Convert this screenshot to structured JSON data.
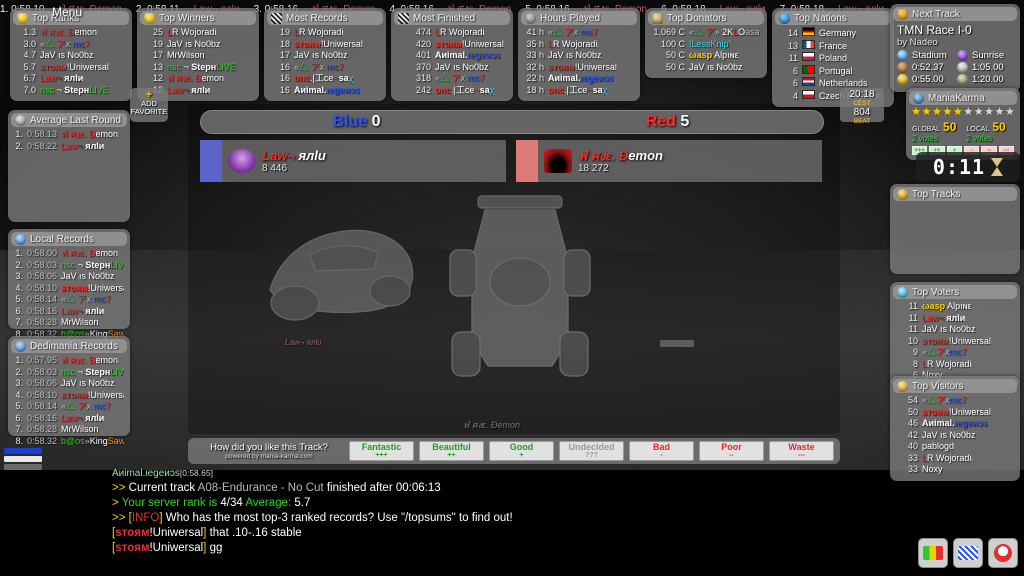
{
  "ticker": [
    "1. 0:58.10",
    "ฟ่ ศงε. Ðemon",
    "2. 0:58.11",
    "Law¬ ялlи",
    "3. 0:58.16",
    "ฟ่ ศงε. Ðemon",
    "4. 0:58.16",
    "ฟ่ ศงε. Ðemon",
    "5. 0:58.16",
    "ฟ่ ศงε. Ðemon",
    "6. 0:58.18",
    "Law¬ ялlи",
    "7. 0:58.18",
    "Law¬ ялlи"
  ],
  "menu_overlay": "Menu",
  "top_panels": [
    {
      "title": "Top Ranks",
      "icon": "cup-icon",
      "rows": [
        {
          "rank": "1.3",
          "name": "ฟ่ ศงε. Ðemon"
        },
        {
          "rank": "3.0",
          "name": "«△ アх mc7"
        },
        {
          "rank": "4.7",
          "name": "JaV ıs No0bz"
        },
        {
          "rank": "5.7",
          "name": "sтoям!Uniwersal"
        },
        {
          "rank": "6.7",
          "name": "Law¬ ялlи"
        },
        {
          "rank": "7.0",
          "name": "nsc ¬ StepнLIVE"
        }
      ]
    },
    {
      "title": "Top Winners",
      "icon": "cup-icon",
      "rows": [
        {
          "rank": "25",
          "name": "LR  Wojoradi"
        },
        {
          "rank": "19",
          "name": "JaV ıs No0bz"
        },
        {
          "rank": "17",
          "name": "MrWilson"
        },
        {
          "rank": "13",
          "name": "nsc ¬ StepнLIVE"
        },
        {
          "rank": "12",
          "name": "ฟ่ ศงε. Ðemon"
        },
        {
          "rank": "12",
          "name": "Law¬ ялlи"
        }
      ]
    },
    {
      "title": "Most Records",
      "icon": "checkered-flag-icon",
      "rows": [
        {
          "rank": "19",
          "name": "LR  Wojoradi"
        },
        {
          "rank": "18",
          "name": "sтoям!Uniwersal"
        },
        {
          "rank": "17",
          "name": "JaV ıs No0bz"
        },
        {
          "rank": "16",
          "name": "«△ アх mc7"
        },
        {
          "rank": "16",
          "name": "onc.|工ce¬saχ"
        },
        {
          "rank": "16",
          "name": "Aиimal.ιegeиɔs"
        }
      ]
    },
    {
      "title": "Most Finished",
      "icon": "checkered-flag-icon",
      "rows": [
        {
          "rank": "474",
          "name": "LR  Wojoradi"
        },
        {
          "rank": "420",
          "name": "sтoям!Uniwersal"
        },
        {
          "rank": "401",
          "name": "Aиimal.ιegeиɔs"
        },
        {
          "rank": "370",
          "name": "JaV ıs No0bz"
        },
        {
          "rank": "318",
          "name": "«△ アх mc7"
        },
        {
          "rank": "242",
          "name": "onc.|工ce¬saχ"
        }
      ]
    },
    {
      "title": "Hours Played",
      "icon": "clock-icon",
      "rows": [
        {
          "rank": "41 h",
          "name": "«△ アх mc7"
        },
        {
          "rank": "35 h",
          "name": "LR  Wojoradi"
        },
        {
          "rank": "33 h",
          "name": "JaV ıs No0bz"
        },
        {
          "rank": "32 h",
          "name": "sтoям!Uniwersal"
        },
        {
          "rank": "22 h",
          "name": "Aиimal.ιegeиɔs"
        },
        {
          "rank": "18 h",
          "name": "onc.|工ce¬saχ"
        }
      ]
    },
    {
      "title": "Top Donators",
      "icon": "money-icon",
      "rows": [
        {
          "rank": "1,069 C",
          "name": "«△ ア» 2KLOasa"
        },
        {
          "rank": "100 C",
          "name": "!LessKnip'"
        },
        {
          "rank": "50 C",
          "name": "ωasp Alpıɴε"
        },
        {
          "rank": "50 C",
          "name": "JaV ıs No0bz"
        }
      ]
    },
    {
      "title": "Top Nations",
      "icon": "globe-icon",
      "rows": [
        {
          "rank": "14",
          "flag": "de",
          "name": "Germany"
        },
        {
          "rank": "13",
          "flag": "fr",
          "name": "France"
        },
        {
          "rank": "11",
          "flag": "pl",
          "name": "Poland"
        },
        {
          "rank": "6",
          "flag": "pt",
          "name": "Portugal"
        },
        {
          "rank": "6",
          "flag": "nl",
          "name": "Netherlands"
        },
        {
          "rank": "4",
          "flag": "cz",
          "name": "Czech Republic"
        }
      ]
    }
  ],
  "left_panels": [
    {
      "title": "Average Last Round",
      "icon": "average-icon",
      "rows": [
        {
          "rank": "1.",
          "time": "0:58.13",
          "name": "ฟ่ ศงε. Ðemon"
        },
        {
          "rank": "2.",
          "time": "0:58.22",
          "name": "Law¬ ялlи"
        }
      ]
    },
    {
      "title": "Local Records",
      "icon": "records-icon",
      "rows": [
        {
          "rank": "1.",
          "time": "0:58.00",
          "name": "ฟ่ ศงε. Ðemon"
        },
        {
          "rank": "2.",
          "time": "0:58.03",
          "name": "nsc ¬ StepнLIVE"
        },
        {
          "rank": "3.",
          "time": "0:58.06",
          "name": "JaV ıs No0bz"
        },
        {
          "rank": "4.",
          "time": "0:58.10",
          "name": "sтoям!Uniwersal"
        },
        {
          "rank": "5.",
          "time": "0:58.14",
          "name": "«△ アх mc7"
        },
        {
          "rank": "6.",
          "time": "0:58.16",
          "name": "Law¬ ялlи"
        },
        {
          "rank": "7.",
          "time": "0:58.28",
          "name": "MrWilson"
        },
        {
          "rank": "8.",
          "time": "0:58.32",
          "name": "b@os»KingSawyer!"
        }
      ]
    },
    {
      "title": "Dedimania Records",
      "icon": "records-icon",
      "rows": [
        {
          "rank": "1.",
          "time": "0:57.95",
          "name": "ฟ่ ศงε. Ðemon"
        },
        {
          "rank": "2.",
          "time": "0:58.03",
          "name": "nsc ¬ StepнLIVE"
        },
        {
          "rank": "3.",
          "time": "0:58.06",
          "name": "JaV ıs No0bz"
        },
        {
          "rank": "4.",
          "time": "0:58.10",
          "name": "sтoям!Uniwersal"
        },
        {
          "rank": "5.",
          "time": "0:58.14",
          "name": "«△ アх mc7"
        },
        {
          "rank": "6.",
          "time": "0:58.16",
          "name": "Law¬ ялlи"
        },
        {
          "rank": "7.",
          "time": "0:58.28",
          "name": "MrWilson"
        },
        {
          "rank": "8.",
          "time": "0:58.32",
          "name": "b@os»KingSawyer!"
        }
      ]
    }
  ],
  "add_favourite": {
    "plus": "+",
    "line1": "ADD",
    "line2": "FAVORITE"
  },
  "clock": {
    "time": "20:18",
    "zone": "CEST",
    "beat": "804",
    "beat_label": "BEAT"
  },
  "next_track": {
    "title": "Next Track",
    "icon": "track-icon",
    "name": "TMN Race I-0",
    "author": "by Nadeo",
    "environment_label": "Stadium",
    "mood_label": "Sunrise",
    "bronze": "0:52.37",
    "silver": "1:05.00",
    "gold": "0:55.00",
    "author_time": "1:20.00"
  },
  "mania_karma": {
    "title": "ManiaKarma",
    "icon": "karma-icon",
    "stars_on": 5,
    "stars_total": 10,
    "global_label": "GLOBAL",
    "global_value": "50",
    "global_votes": "2 votes",
    "local_label": "LOCAL",
    "local_value": "50",
    "local_votes": "2 votes",
    "cells": [
      "+++",
      "++",
      "+",
      "-",
      "--",
      "---"
    ]
  },
  "big_timer": {
    "value": "0:11",
    "icon": "hourglass-icon"
  },
  "top_voters": {
    "title": "Top Voters",
    "icon": "voter-icon",
    "rows": [
      {
        "rank": "11",
        "name": "ωasp Alpıɴε"
      },
      {
        "rank": "11",
        "name": "Law¬ ялlи"
      },
      {
        "rank": "11",
        "name": "JaV ıs No0bz"
      },
      {
        "rank": "10",
        "name": "sтoям!Uniwersal"
      },
      {
        "rank": "9",
        "name": "«△ アхmc7"
      },
      {
        "rank": "8",
        "name": "LR  Wojoradi"
      },
      {
        "rank": "6",
        "name": "Noxy"
      }
    ]
  },
  "top_visitors": {
    "title": "Top Visitors",
    "icon": "visitor-icon",
    "rows": [
      {
        "rank": "54",
        "name": "«△ アхmc7"
      },
      {
        "rank": "50",
        "name": "sтoям!Uniwersal"
      },
      {
        "rank": "46",
        "name": "Aиimal.ιegeиɔs"
      },
      {
        "rank": "42",
        "name": "JaV ıs No0bz"
      },
      {
        "rank": "40",
        "name": "pablogd"
      },
      {
        "rank": "33",
        "name": "LR  Wojoradi"
      },
      {
        "rank": "33",
        "name": "Noxy"
      }
    ]
  },
  "scoreboard": {
    "blue_label": "Blue",
    "blue_score": "0",
    "red_label": "Red",
    "red_score": "5",
    "blue_player": {
      "name": "Law¬ ялlи",
      "points": "8 446",
      "avatar": "law-avatar"
    },
    "red_player": {
      "name": "ฟ่ ศงε. Ðemon",
      "points": "18 272",
      "avatar": "demon-avatar"
    }
  },
  "car_labels": {
    "left": "Law¬ ялlи",
    "right": "ฟ่ ศงε. Ðemon"
  },
  "karma_vote": {
    "question": "How did you like this Track?",
    "powered": "powered by mania-karma.com",
    "buttons": [
      {
        "label": "Fantastic",
        "sub": "+++",
        "kind": "pos"
      },
      {
        "label": "Beautiful",
        "sub": "++",
        "kind": "pos"
      },
      {
        "label": "Good",
        "sub": "+",
        "kind": "pos"
      },
      {
        "label": "Undecided",
        "sub": "???",
        "kind": "und"
      },
      {
        "label": "Bad",
        "sub": "-",
        "kind": "neg"
      },
      {
        "label": "Poor",
        "sub": "--",
        "kind": "neg"
      },
      {
        "label": "Waste",
        "sub": "---",
        "kind": "neg"
      }
    ]
  },
  "chat": {
    "header_name": "Aиimal.ιegeиɔs",
    "header_time": "[0:58.65]",
    "lines": [
      ">> Current track A08-Endurance - No Cut finished after 00:06:13",
      "> Your server rank is 4/34 Average: 5.7",
      ">> [INFO] Who has the most top-3 ranked records?  Use \"/topsums\" to find out!",
      "[sтoям!Uniwersal] that .10-.16 stable",
      "[sтoям!Uniwersal] gg"
    ]
  },
  "bottom_buttons": [
    "chart-icon",
    "flag-icon",
    "face-icon"
  ]
}
